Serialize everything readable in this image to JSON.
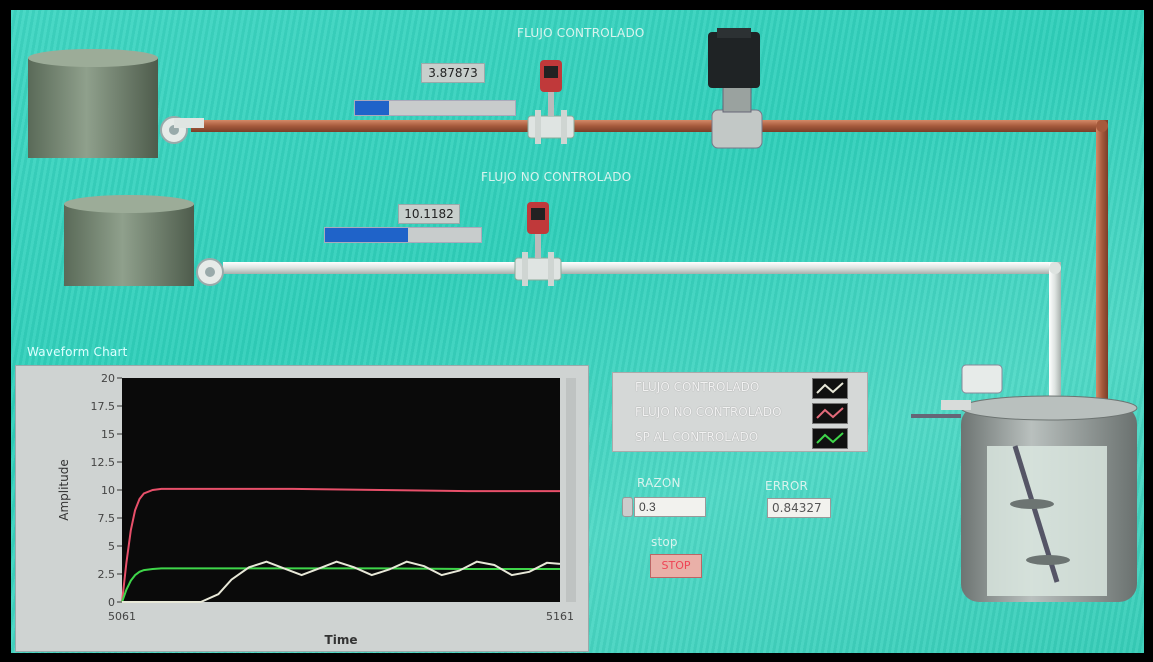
{
  "labels": {
    "flujo_controlado_title": "FLUJO CONTROLADO",
    "flujo_no_controlado_title": "FLUJO NO CONTROLADO",
    "chart_title": "Waveform Chart",
    "razon_label": "RAZON",
    "error_label": "ERROR",
    "stop_label": "stop"
  },
  "indicators": {
    "flujo_controlado_value": "3.87873",
    "flujo_controlado_bar_fraction": 0.21,
    "flujo_no_controlado_value": "10.1182",
    "flujo_no_controlado_bar_fraction": 0.53,
    "razon_value": "0.3",
    "error_value": "0.84327",
    "stop_button": "STOP"
  },
  "legend": {
    "items": [
      {
        "label": "FLUJO CONTROLADO",
        "color": "#e8e8d8"
      },
      {
        "label": "FLUJO NO CONTROLADO",
        "color": "#e26a7a"
      },
      {
        "label": "SP AL CONTROLADO",
        "color": "#3fd64a"
      }
    ]
  },
  "colors": {
    "panel_bg": "#36d2bc",
    "pipe_controlled": "#b86e4e",
    "pipe_uncontrolled": "#e6ebe8",
    "bar_fill": "#1f63c9"
  },
  "chart_data": {
    "type": "line",
    "xlabel": "Time",
    "ylabel": "Amplitude",
    "xlim": [
      5061,
      5161
    ],
    "ylim": [
      0,
      20
    ],
    "y_ticks": [
      "0",
      "2.5",
      "5",
      "7.5",
      "10",
      "12.5",
      "15",
      "17.5",
      "20"
    ],
    "x_ticks": [
      "5061",
      "5161"
    ],
    "grid": false,
    "series": [
      {
        "name": "FLUJO NO CONTROLADO",
        "color": "#e8506a",
        "x": [
          5061,
          5062,
          5063,
          5064,
          5065,
          5066,
          5068,
          5070,
          5075,
          5080,
          5100,
          5120,
          5140,
          5161
        ],
        "y": [
          0,
          3.5,
          6.4,
          8.2,
          9.2,
          9.7,
          10.0,
          10.1,
          10.1,
          10.1,
          10.1,
          10.0,
          9.9,
          9.9
        ]
      },
      {
        "name": "SP AL CONTROLADO",
        "color": "#3fd64a",
        "x": [
          5061,
          5062,
          5063,
          5064,
          5065,
          5066,
          5068,
          5070,
          5075,
          5080,
          5100,
          5120,
          5140,
          5161
        ],
        "y": [
          0,
          1.1,
          1.9,
          2.4,
          2.7,
          2.85,
          2.95,
          3.0,
          3.0,
          3.0,
          3.0,
          3.0,
          2.95,
          2.95
        ]
      },
      {
        "name": "FLUJO CONTROLADO",
        "color": "#e8e8d8",
        "x": [
          5061,
          5079,
          5083,
          5086,
          5090,
          5094,
          5098,
          5102,
          5106,
          5110,
          5114,
          5118,
          5122,
          5126,
          5130,
          5134,
          5138,
          5142,
          5146,
          5150,
          5154,
          5158,
          5161
        ],
        "y": [
          0,
          0,
          0.7,
          2.0,
          3.1,
          3.6,
          3.0,
          2.4,
          3.0,
          3.6,
          3.1,
          2.4,
          2.9,
          3.6,
          3.2,
          2.4,
          2.8,
          3.6,
          3.3,
          2.4,
          2.7,
          3.5,
          3.4
        ]
      }
    ]
  }
}
